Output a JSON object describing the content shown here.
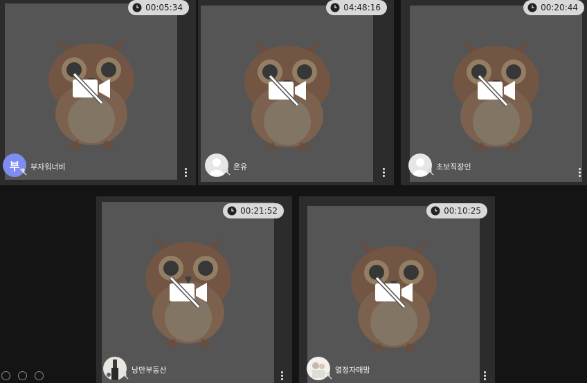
{
  "participants": [
    {
      "name": "부자워너비",
      "timer": "00:05:34",
      "avatar_type": "letter",
      "avatar_letter": "부",
      "avatar_color": "#7f8cf1",
      "video": "off",
      "mic": "muted"
    },
    {
      "name": "온유",
      "timer": "04:48:16",
      "avatar_type": "default",
      "video": "off",
      "mic": "muted"
    },
    {
      "name": "초보직장인",
      "timer": "00:20:44",
      "avatar_type": "default",
      "video": "off",
      "mic": "muted"
    },
    {
      "name": "낭만부동산",
      "timer": "00:21:52",
      "avatar_type": "photo",
      "video": "off",
      "mic": "muted"
    },
    {
      "name": "열정자매맘",
      "timer": "00:10:25",
      "avatar_type": "photo",
      "video": "off",
      "mic": "muted"
    }
  ],
  "colors": {
    "background": "#141414",
    "tile": "#2c2c2c",
    "video_placeholder": "#555555",
    "timer_pill": "#d9d9d9"
  }
}
